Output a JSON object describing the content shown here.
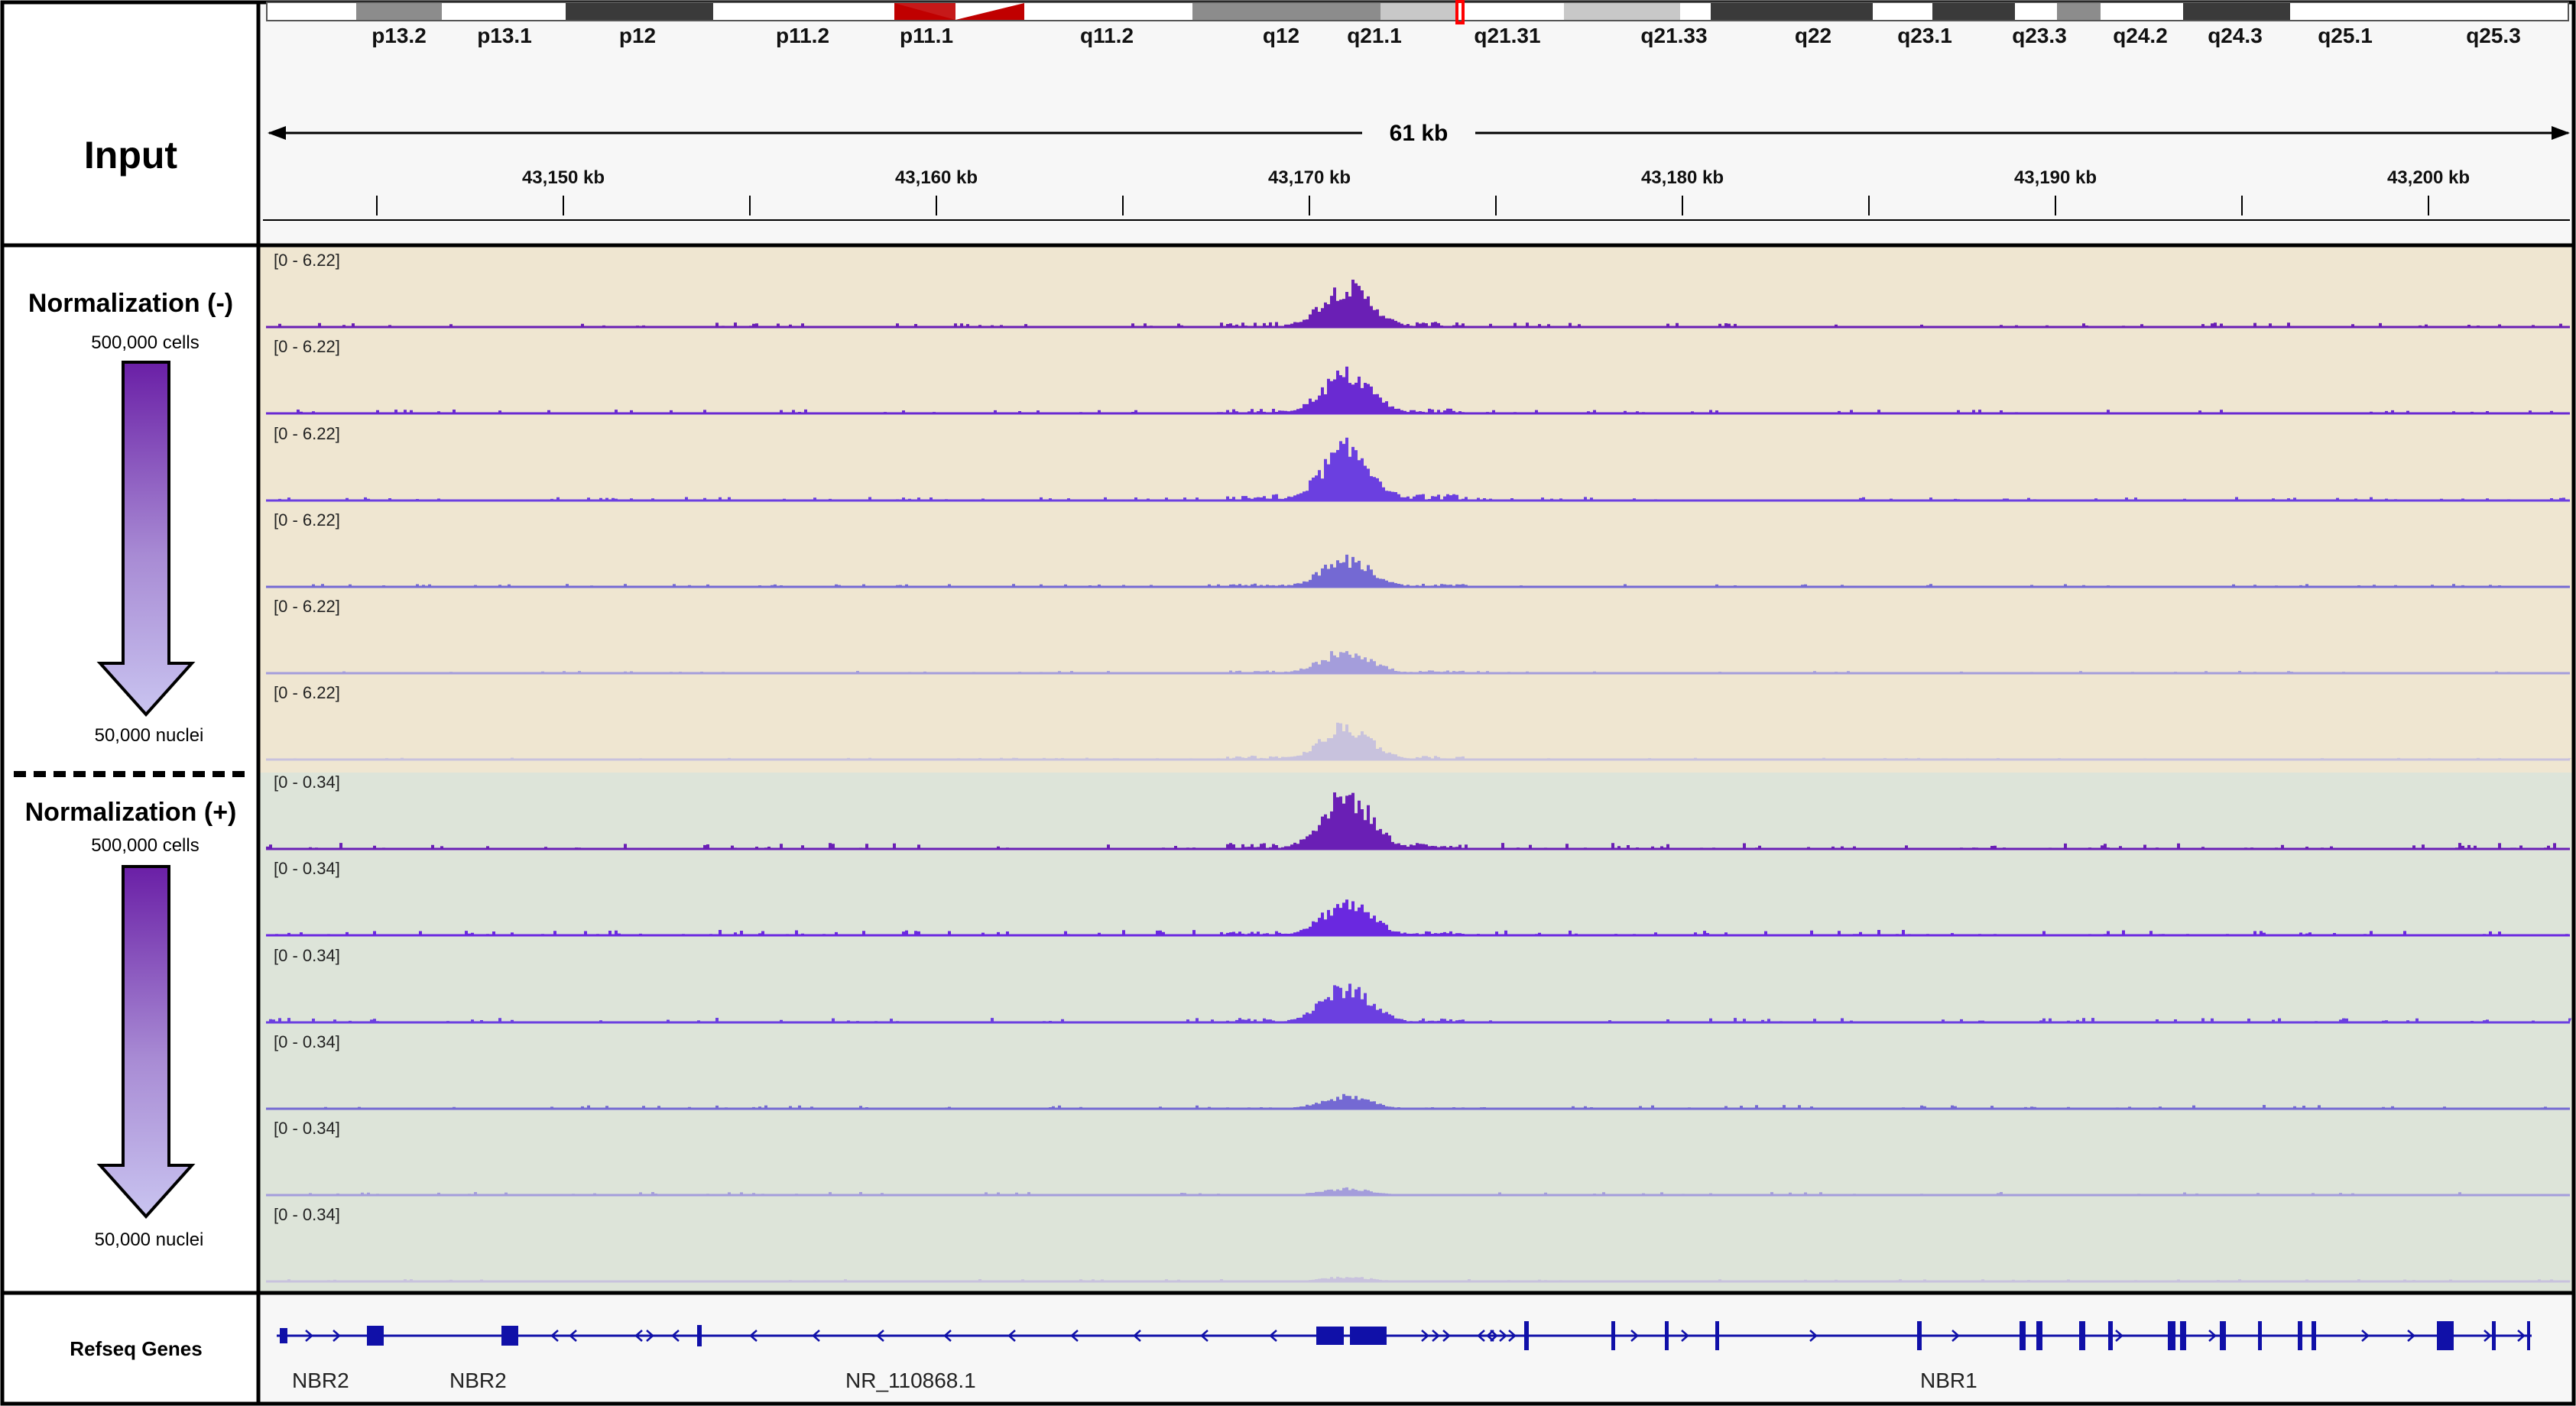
{
  "input_label": "Input",
  "ideogram_bands": [
    {
      "label": "p13.2",
      "stain": "gpos50"
    },
    {
      "label": "p13.1",
      "stain": "gneg"
    },
    {
      "label": "p12",
      "stain": "gpos100"
    },
    {
      "label": "p11.2",
      "stain": "gneg"
    },
    {
      "label": "p11.1",
      "stain": "acen"
    },
    {
      "label": "q11.2",
      "stain": "gneg"
    },
    {
      "label": "q12",
      "stain": "gpos50"
    },
    {
      "label": "q21.1",
      "stain": "gpos25"
    },
    {
      "label": "q21.31",
      "stain": "gneg"
    },
    {
      "label": "q21.33",
      "stain": "gpos25"
    },
    {
      "label": "q22",
      "stain": "gpos100"
    },
    {
      "label": "q23.1",
      "stain": "gpos100"
    },
    {
      "label": "q23.3",
      "stain": "gpos50"
    },
    {
      "label": "q24.2",
      "stain": "gneg"
    },
    {
      "label": "q24.3",
      "stain": "gpos100"
    },
    {
      "label": "q25.1",
      "stain": "gneg"
    },
    {
      "label": "q25.3",
      "stain": "gneg"
    }
  ],
  "ruler": {
    "span_label": "61 kb",
    "ticks": [
      "43,150 kb",
      "43,160 kb",
      "43,170 kb",
      "43,180 kb",
      "43,190 kb",
      "43,200 kb"
    ]
  },
  "groups": [
    {
      "title": "Normalization (-)",
      "top_label": "500,000 cells",
      "bottom_label": "50,000 nuclei",
      "background": "#efe6d1",
      "track_range": "[0 - 6.22]",
      "track_colors": [
        "#6a1fb5",
        "#6a2ad2",
        "#6b3fe0",
        "#7469d3",
        "#a49ddb",
        "#c8c2dd"
      ],
      "peak_heights": [
        0.72,
        0.7,
        0.92,
        0.48,
        0.4,
        0.58
      ]
    },
    {
      "title": "Normalization (+)",
      "top_label": "500,000 cells",
      "bottom_label": "50,000 nuclei",
      "background": "#dde4d9",
      "track_range": "[0 - 0.34]",
      "track_colors": [
        "#6a1fb5",
        "#6a28e0",
        "#6b3fe0",
        "#7469d3",
        "#a49ddb",
        "#c8c2dd"
      ],
      "peak_heights": [
        0.95,
        0.58,
        0.62,
        0.22,
        0.12,
        0.08
      ]
    }
  ],
  "genes": {
    "track_label": "Refseq Genes",
    "color": "#1010a8",
    "names": [
      "NBR2",
      "NBR2",
      "NR_110868.1",
      "NBR1"
    ]
  }
}
